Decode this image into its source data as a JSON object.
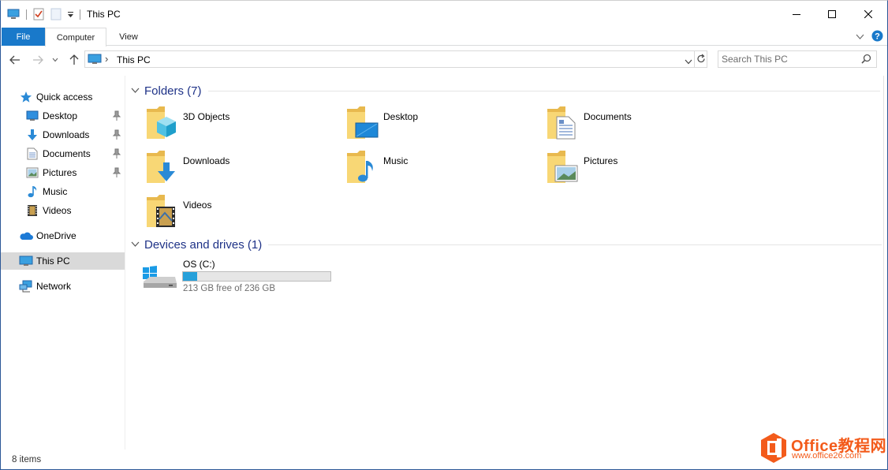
{
  "window": {
    "title": "This PC",
    "buttons": {
      "minimize": "minimize",
      "maximize": "maximize",
      "close": "close"
    }
  },
  "ribbon": {
    "tabs": [
      {
        "label": "File"
      },
      {
        "label": "Computer"
      },
      {
        "label": "View"
      }
    ]
  },
  "address": {
    "path": "This PC",
    "separator": "›"
  },
  "search": {
    "placeholder": "Search This PC"
  },
  "sidebar": {
    "items": [
      {
        "label": "Quick access",
        "icon": "star-icon"
      },
      {
        "label": "Desktop",
        "icon": "desktop-icon",
        "pinned": true
      },
      {
        "label": "Downloads",
        "icon": "download-arrow-icon",
        "pinned": true
      },
      {
        "label": "Documents",
        "icon": "document-icon",
        "pinned": true
      },
      {
        "label": "Pictures",
        "icon": "pictures-icon",
        "pinned": true
      },
      {
        "label": "Music",
        "icon": "music-note-icon"
      },
      {
        "label": "Videos",
        "icon": "film-icon"
      },
      {
        "label": "OneDrive",
        "icon": "cloud-icon"
      },
      {
        "label": "This PC",
        "icon": "computer-icon",
        "selected": true
      },
      {
        "label": "Network",
        "icon": "network-icon"
      }
    ]
  },
  "folders": {
    "title": "Folders (7)",
    "items": [
      {
        "name": "3D Objects",
        "icon": "3d-objects-folder-icon"
      },
      {
        "name": "Desktop",
        "icon": "desktop-folder-icon"
      },
      {
        "name": "Documents",
        "icon": "documents-folder-icon"
      },
      {
        "name": "Downloads",
        "icon": "downloads-folder-icon"
      },
      {
        "name": "Music",
        "icon": "music-folder-icon"
      },
      {
        "name": "Pictures",
        "icon": "pictures-folder-icon"
      },
      {
        "name": "Videos",
        "icon": "videos-folder-icon"
      }
    ]
  },
  "drives": {
    "title": "Devices and drives (1)",
    "items": [
      {
        "name": "OS (C:)",
        "free_text": "213 GB free of 236 GB",
        "used_fraction": 0.097
      }
    ]
  },
  "status": {
    "item_count": "8 items"
  },
  "watermark": {
    "title": "Office教程网",
    "url": "www.office26.com"
  },
  "colors": {
    "accent": "#1979ca",
    "group_header": "#1e3287",
    "folder_yellow": "#f8d775",
    "drive_bar": "#26a0da",
    "watermark": "#f35b1b"
  }
}
